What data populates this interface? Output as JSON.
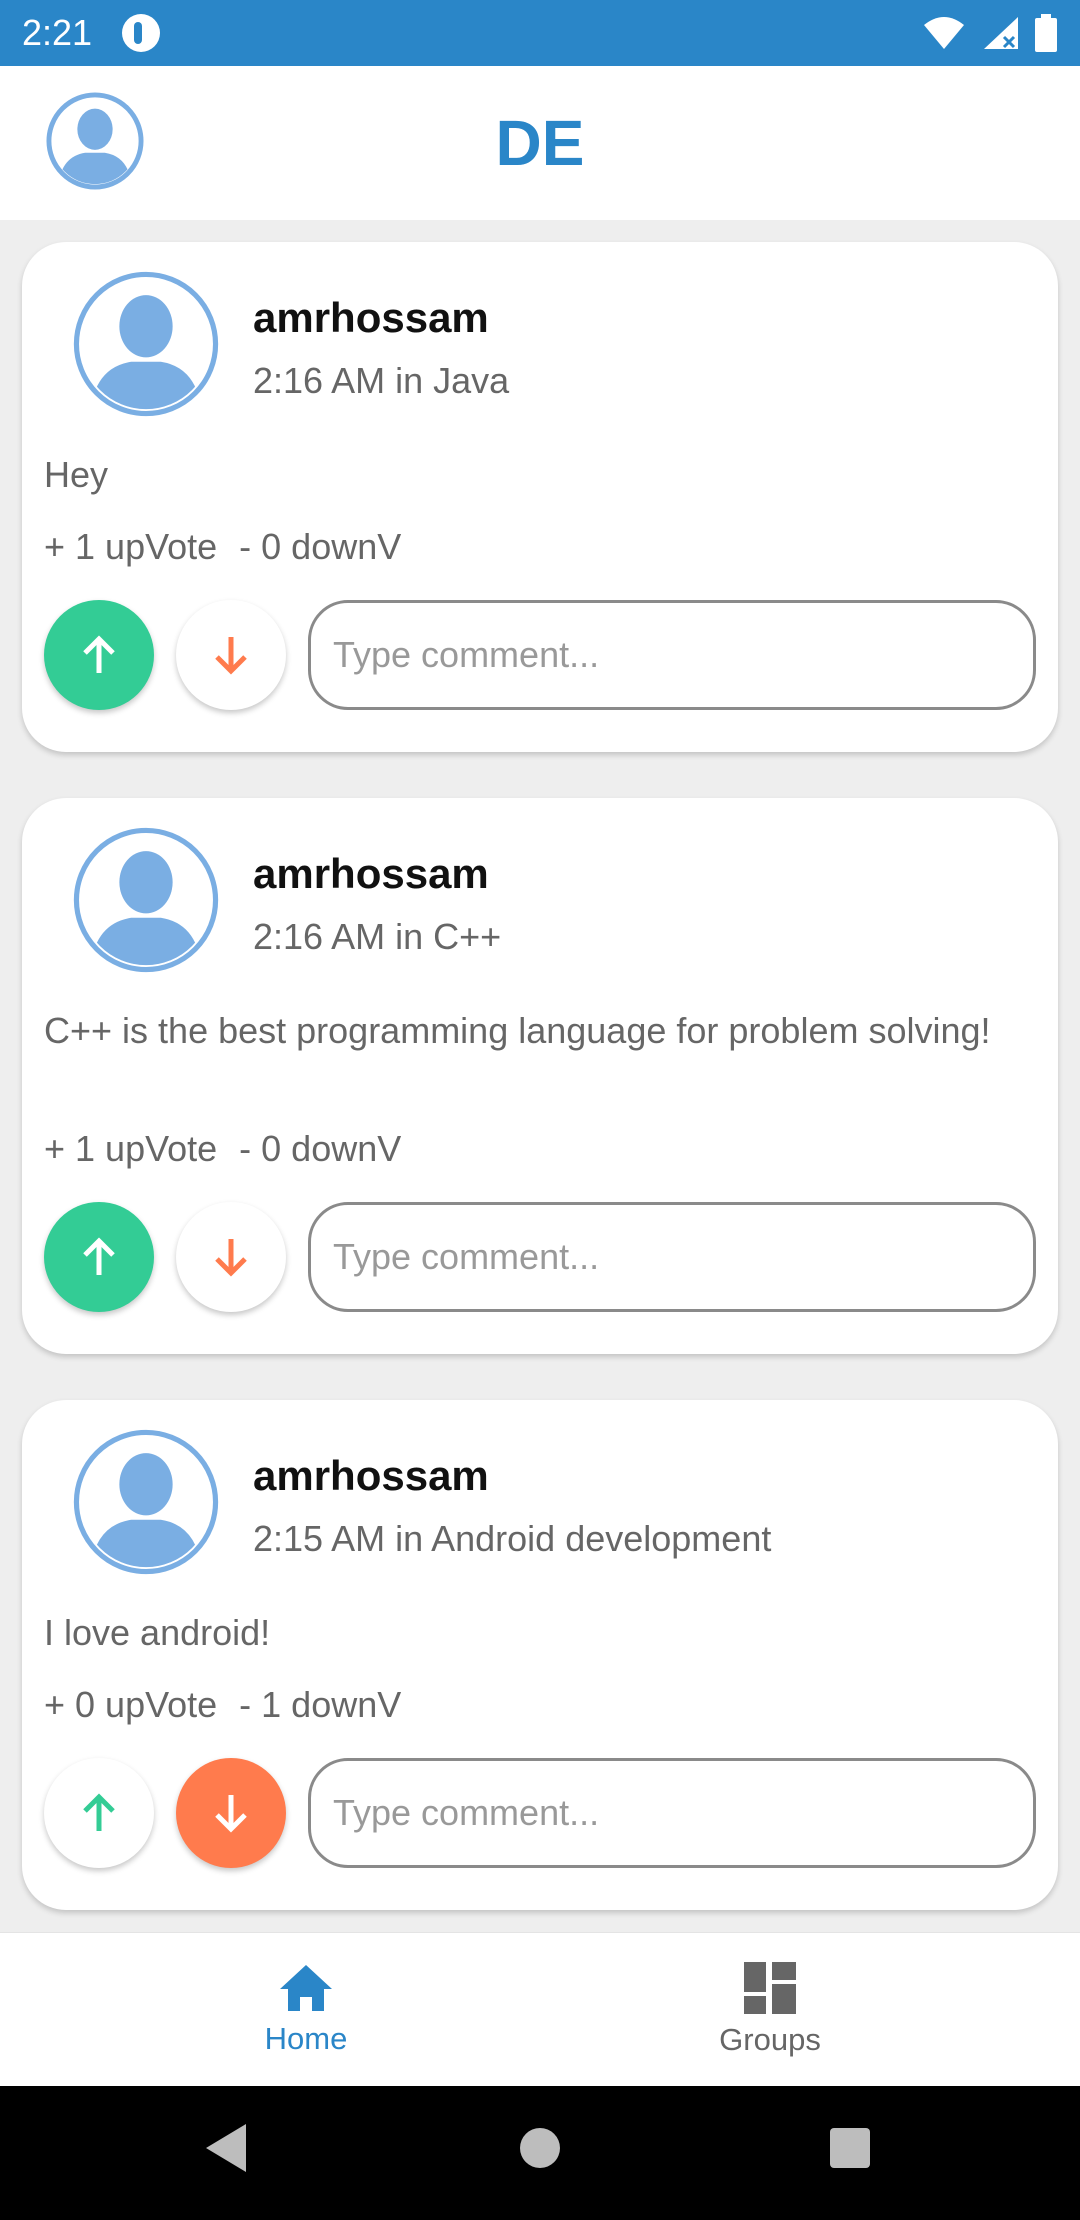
{
  "status_bar": {
    "time": "2:21",
    "icons": [
      "app-notification-icon",
      "wifi-icon",
      "signal-icon",
      "battery-icon"
    ]
  },
  "app_bar": {
    "title": "DE",
    "avatar_icon": "profile-avatar-icon"
  },
  "colors": {
    "primary": "#2a86c8",
    "upvote": "#33cc95",
    "downvote": "#ff7b4d",
    "avatar": "#7aaee3"
  },
  "posts": [
    {
      "author": "amrhossam",
      "meta": "2:16 AM in Java",
      "body": "Hey",
      "up_text": "+ 1 upVote",
      "down_text": "- 0 downV",
      "upvote_active": true,
      "downvote_active": false,
      "comment_placeholder": "Type comment..."
    },
    {
      "author": "amrhossam",
      "meta": "2:16 AM in C++",
      "body": "C++ is the best programming language for problem solving!",
      "up_text": "+ 1 upVote",
      "down_text": "- 0 downV",
      "upvote_active": true,
      "downvote_active": false,
      "comment_placeholder": "Type comment..."
    },
    {
      "author": "amrhossam",
      "meta": "2:15 AM in Android development",
      "body": "I love android!",
      "up_text": "+ 0 upVote",
      "down_text": "- 1 downV",
      "upvote_active": false,
      "downvote_active": true,
      "comment_placeholder": "Type comment..."
    }
  ],
  "bottom_nav": [
    {
      "label": "Home",
      "icon": "home-icon",
      "active": true
    },
    {
      "label": "Groups",
      "icon": "dashboard-icon",
      "active": false
    }
  ],
  "system_nav": [
    "back-icon",
    "home-circle-icon",
    "recents-icon"
  ]
}
